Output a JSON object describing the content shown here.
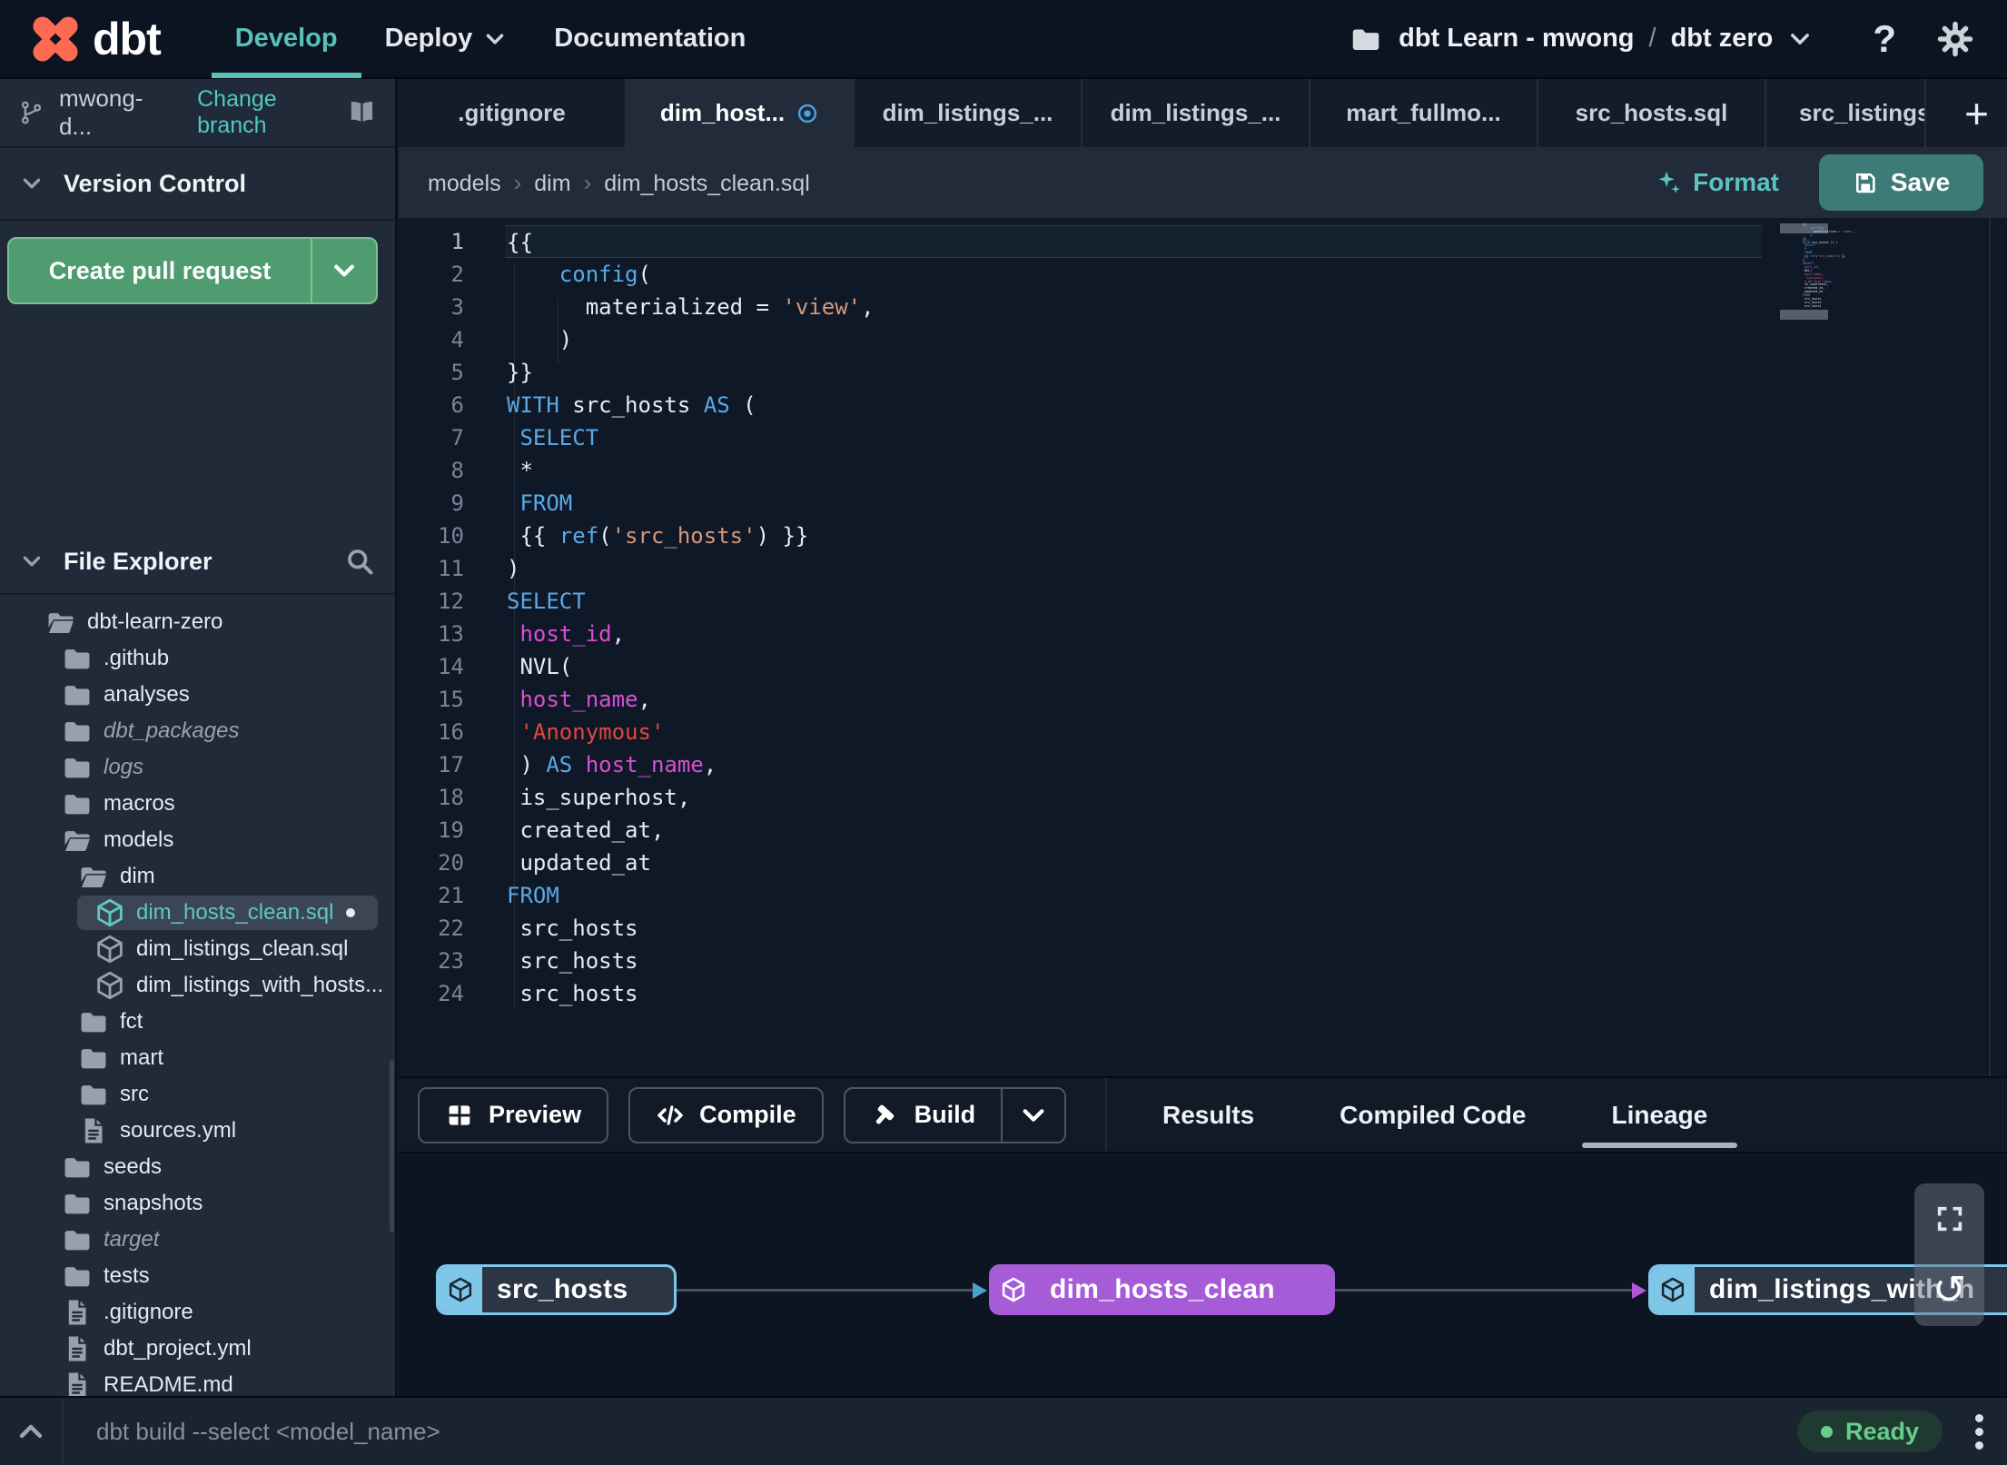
{
  "navbar": {
    "brand": "dbt",
    "items": [
      {
        "label": "Develop",
        "active": true
      },
      {
        "label": "Deploy",
        "chevron": true
      },
      {
        "label": "Documentation"
      }
    ],
    "project": {
      "account": "dbt Learn - mwong",
      "separator": "/",
      "env": "dbt zero"
    },
    "help_label": "?"
  },
  "sidebar": {
    "branch": {
      "name": "mwong-d...",
      "change_label": "Change branch"
    },
    "version_control": {
      "title": "Version Control",
      "button_label": "Create pull request"
    },
    "file_explorer": {
      "title": "File Explorer",
      "tree": [
        {
          "label": "dbt-learn-zero",
          "icon": "folder-open",
          "level": 0
        },
        {
          "label": ".github",
          "icon": "folder",
          "level": 1
        },
        {
          "label": "analyses",
          "icon": "folder",
          "level": 1
        },
        {
          "label": "dbt_packages",
          "icon": "folder",
          "level": 1,
          "italic": true
        },
        {
          "label": "logs",
          "icon": "folder",
          "level": 1,
          "italic": true
        },
        {
          "label": "macros",
          "icon": "folder",
          "level": 1
        },
        {
          "label": "models",
          "icon": "folder-open",
          "level": 1
        },
        {
          "label": "dim",
          "icon": "folder-open",
          "level": 2
        },
        {
          "label": "dim_hosts_clean.sql",
          "icon": "model",
          "level": 3,
          "selected": true,
          "dot": true
        },
        {
          "label": "dim_listings_clean.sql",
          "icon": "model",
          "level": 3
        },
        {
          "label": "dim_listings_with_hosts...",
          "icon": "model",
          "level": 3
        },
        {
          "label": "fct",
          "icon": "folder",
          "level": 2
        },
        {
          "label": "mart",
          "icon": "folder",
          "level": 2
        },
        {
          "label": "src",
          "icon": "folder",
          "level": 2
        },
        {
          "label": "sources.yml",
          "icon": "file",
          "level": 2
        },
        {
          "label": "seeds",
          "icon": "folder",
          "level": 1
        },
        {
          "label": "snapshots",
          "icon": "folder",
          "level": 1
        },
        {
          "label": "target",
          "icon": "folder",
          "level": 1,
          "italic": true
        },
        {
          "label": "tests",
          "icon": "folder",
          "level": 1
        },
        {
          "label": ".gitignore",
          "icon": "file",
          "level": 1
        },
        {
          "label": "dbt_project.yml",
          "icon": "file",
          "level": 1
        },
        {
          "label": "README.md",
          "icon": "file",
          "level": 1
        }
      ]
    }
  },
  "tabs": {
    "items": [
      {
        "label": ".gitignore"
      },
      {
        "label": "dim_host...",
        "active": true,
        "modified": true
      },
      {
        "label": "dim_listings_..."
      },
      {
        "label": "dim_listings_..."
      },
      {
        "label": "mart_fullmo..."
      },
      {
        "label": "src_hosts.sql"
      },
      {
        "label": "src_listings.",
        "clipped": true
      }
    ],
    "add_label": "+"
  },
  "editor": {
    "breadcrumb": [
      "models",
      "dim",
      "dim_hosts_clean.sql"
    ],
    "format_label": "Format",
    "save_label": "Save",
    "lines": [
      {
        "n": 1,
        "current": true,
        "t": [
          [
            "{{",
            "d"
          ]
        ]
      },
      {
        "n": 2,
        "t": [
          [
            "    ",
            "d"
          ],
          [
            "config",
            "kw"
          ],
          [
            "(",
            "d"
          ]
        ]
      },
      {
        "n": 3,
        "t": [
          [
            "      materialized = ",
            "d"
          ],
          [
            "'view'",
            "str"
          ],
          [
            ",",
            "d"
          ]
        ]
      },
      {
        "n": 4,
        "t": [
          [
            "    )",
            "d"
          ]
        ]
      },
      {
        "n": 5,
        "t": [
          [
            "}}",
            "d"
          ]
        ]
      },
      {
        "n": 6,
        "t": [
          [
            "WITH ",
            "kw"
          ],
          [
            "src_hosts ",
            "d"
          ],
          [
            "AS ",
            "kw"
          ],
          [
            "(",
            "d"
          ]
        ]
      },
      {
        "n": 7,
        "t": [
          [
            " ",
            "d"
          ],
          [
            "SELECT",
            "kw"
          ]
        ]
      },
      {
        "n": 8,
        "t": [
          [
            " *",
            "d"
          ]
        ]
      },
      {
        "n": 9,
        "t": [
          [
            " ",
            "d"
          ],
          [
            "FROM",
            "kw"
          ]
        ]
      },
      {
        "n": 10,
        "t": [
          [
            " {{ ",
            "d"
          ],
          [
            "ref",
            "kw"
          ],
          [
            "(",
            "d"
          ],
          [
            "'src_hosts'",
            "str"
          ],
          [
            ") }}",
            "d"
          ]
        ]
      },
      {
        "n": 11,
        "t": [
          [
            ")",
            "d"
          ]
        ]
      },
      {
        "n": 12,
        "t": [
          [
            "SELECT",
            "kw"
          ]
        ]
      },
      {
        "n": 13,
        "t": [
          [
            " ",
            "d"
          ],
          [
            "host_id",
            "var"
          ],
          [
            ",",
            "d"
          ]
        ]
      },
      {
        "n": 14,
        "t": [
          [
            " NVL(",
            "d"
          ]
        ]
      },
      {
        "n": 15,
        "t": [
          [
            " ",
            "d"
          ],
          [
            "host_name",
            "var"
          ],
          [
            ",",
            "d"
          ]
        ]
      },
      {
        "n": 16,
        "t": [
          [
            " ",
            "d"
          ],
          [
            "'Anonymous'",
            "str2"
          ]
        ]
      },
      {
        "n": 17,
        "t": [
          [
            " ) ",
            "d"
          ],
          [
            "AS ",
            "kw"
          ],
          [
            "host_name",
            "var"
          ],
          [
            ",",
            "d"
          ]
        ]
      },
      {
        "n": 18,
        "t": [
          [
            " is_superhost,",
            "d"
          ]
        ]
      },
      {
        "n": 19,
        "t": [
          [
            " created_at,",
            "d"
          ]
        ]
      },
      {
        "n": 20,
        "t": [
          [
            " updated_at",
            "d"
          ]
        ]
      },
      {
        "n": 21,
        "t": [
          [
            "FROM",
            "kw"
          ]
        ]
      },
      {
        "n": 22,
        "t": [
          [
            " src_hosts",
            "d"
          ]
        ]
      },
      {
        "n": 23,
        "t": [
          [
            " src_hosts",
            "d"
          ]
        ]
      },
      {
        "n": 24,
        "t": [
          [
            " src_hosts",
            "d"
          ]
        ]
      }
    ]
  },
  "bottom": {
    "actions": [
      {
        "label": "Preview",
        "icon": "grid"
      },
      {
        "label": "Compile",
        "icon": "code"
      },
      {
        "label": "Build",
        "icon": "hammer",
        "split": true
      }
    ],
    "tabs": [
      {
        "label": "Results"
      },
      {
        "label": "Compiled Code"
      },
      {
        "label": "Lineage",
        "active": true
      }
    ]
  },
  "lineage": {
    "nodes": [
      {
        "label": "src_hosts",
        "style": "blue"
      },
      {
        "label": "dim_hosts_clean",
        "style": "purple"
      },
      {
        "label": "dim_listings_with_h",
        "style": "blue"
      }
    ]
  },
  "statusbar": {
    "command": "dbt build --select <model_name>",
    "status": "Ready"
  },
  "colors": {
    "accent_teal": "#58c1bc",
    "save_button": "#3d7b78",
    "pr_button": "#4e9c70",
    "node_blue": "#7ec7e9",
    "node_purple": "#a75cd7",
    "ready_green": "#66cd8c",
    "logo_orange": "#ff6a52",
    "modified_dot_blue": "#4da3e8",
    "syntax": {
      "keyword": "#5aa9e6",
      "string": "#d49a7a",
      "string_red": "#e0483e",
      "identifier": "#da4fd4",
      "default": "#e8ecf2"
    }
  }
}
